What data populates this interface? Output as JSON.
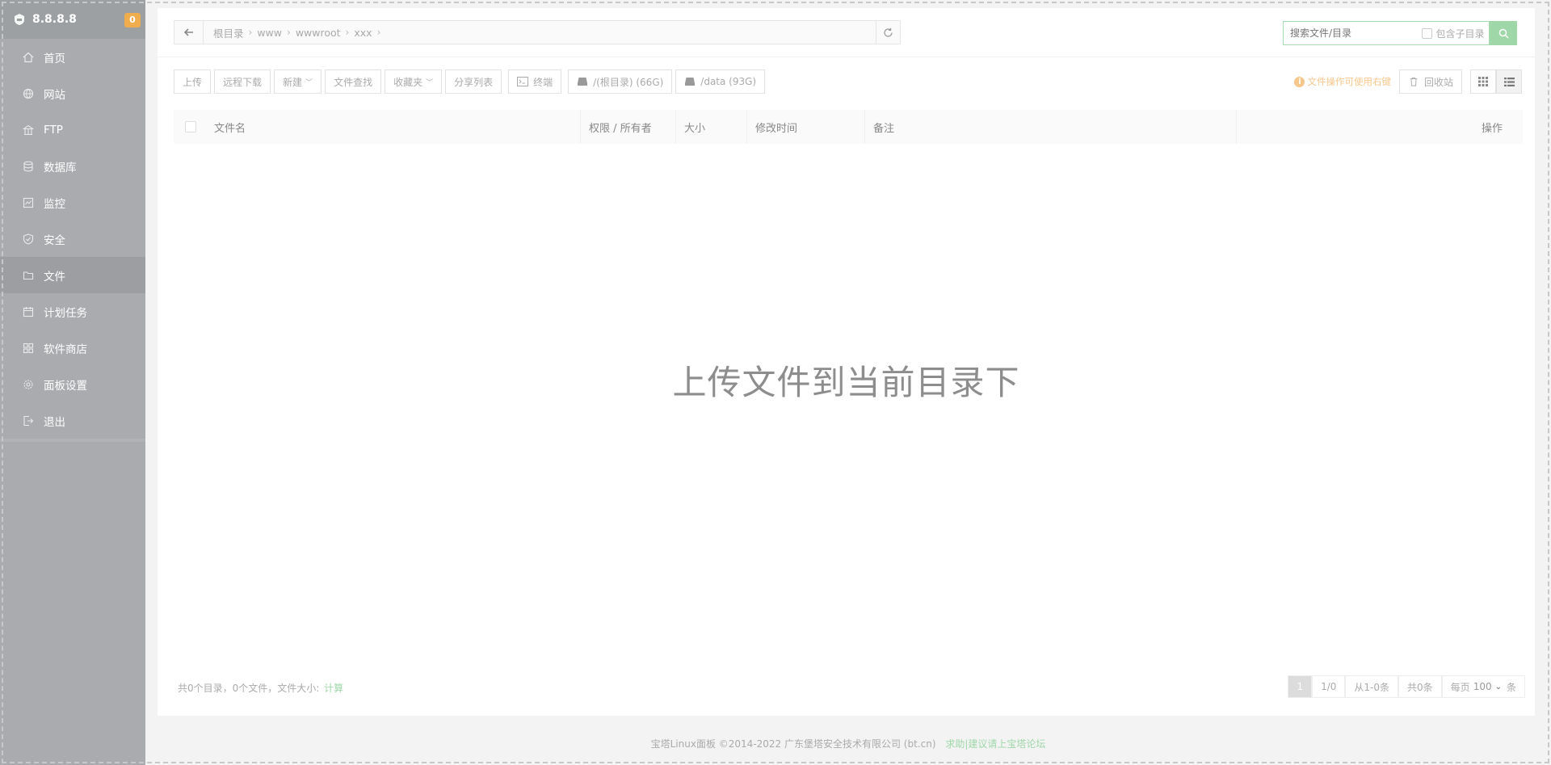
{
  "sidebar": {
    "ip": "8.8.8.8",
    "badge": "0",
    "items": [
      {
        "label": "首页",
        "icon": "home-icon"
      },
      {
        "label": "网站",
        "icon": "globe-icon"
      },
      {
        "label": "FTP",
        "icon": "ftp-icon"
      },
      {
        "label": "数据库",
        "icon": "database-icon"
      },
      {
        "label": "监控",
        "icon": "monitor-icon"
      },
      {
        "label": "安全",
        "icon": "shield-icon"
      },
      {
        "label": "文件",
        "icon": "folder-icon"
      },
      {
        "label": "计划任务",
        "icon": "calendar-icon"
      },
      {
        "label": "软件商店",
        "icon": "apps-icon"
      },
      {
        "label": "面板设置",
        "icon": "gear-icon"
      },
      {
        "label": "退出",
        "icon": "logout-icon"
      }
    ]
  },
  "path": {
    "crumbs": [
      "根目录",
      "www",
      "wwwroot",
      "xxx"
    ]
  },
  "search": {
    "placeholder": "搜索文件/目录",
    "subdir_label": "包含子目录"
  },
  "toolbar": {
    "upload": "上传",
    "remote_download": "远程下载",
    "new": "新建",
    "find": "文件查找",
    "favorites": "收藏夹",
    "share_list": "分享列表",
    "terminal": "终端",
    "disk_root": "/(根目录) (66G)",
    "disk_data": "/data (93G)",
    "tip": "文件操作可使用右键",
    "recycle": "回收站"
  },
  "table": {
    "col_name": "文件名",
    "col_perm": "权限 / 所有者",
    "col_size": "大小",
    "col_mtime": "修改时间",
    "col_note": "备注",
    "col_op": "操作"
  },
  "drop_message": "上传文件到当前目录下",
  "summary": {
    "text": "共0个目录，0个文件，文件大小:",
    "calc": "计算"
  },
  "pager": {
    "current": "1",
    "pages": "1/0",
    "range": "从1-0条",
    "total": "共0条",
    "per_page_label": "每页",
    "per_page_value": "100",
    "unit": "条"
  },
  "footer": {
    "copyright": "宝塔Linux面板 ©2014-2022 广东堡塔安全技术有限公司 (bt.cn)",
    "help": "求助|建议请上宝塔论坛"
  }
}
